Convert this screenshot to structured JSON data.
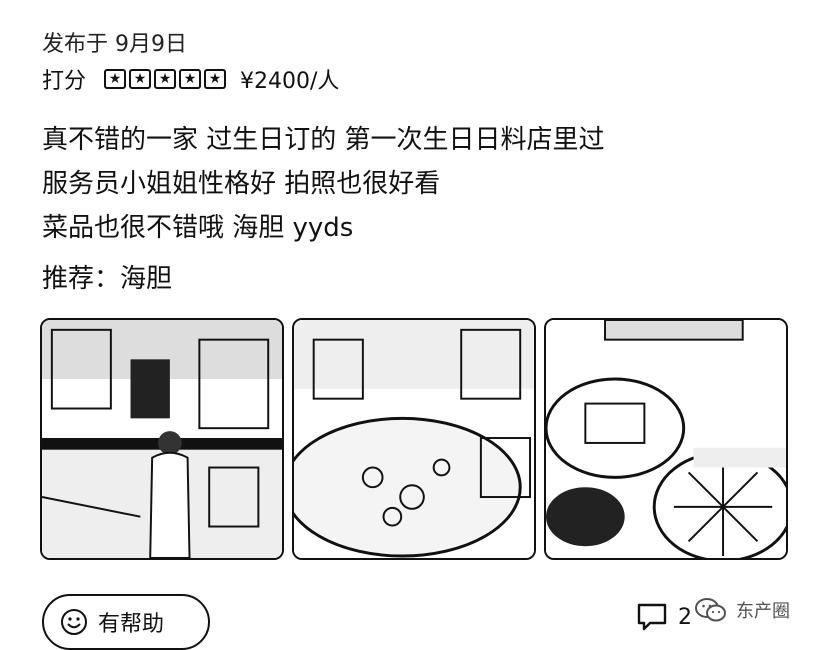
{
  "post": {
    "date": "发布于 9月9日",
    "rating_label": "打分",
    "rating_stars": 5,
    "price": "¥2400/人"
  },
  "review": {
    "lines": [
      "真不错的一家 过生日订的 第一次生日日料店里过",
      "服务员小姐姐性格好 拍照也很好看",
      "菜品也很不错哦 海胆 yyds"
    ]
  },
  "recommend": "推荐：海胆",
  "photos": [
    {
      "icon": "restaurant-interior-photo"
    },
    {
      "icon": "dish-platter-photo"
    },
    {
      "icon": "sea-urchin-dish-photo"
    }
  ],
  "actions": {
    "helpful_label": "有帮助",
    "comment_count": "2"
  },
  "watermark": {
    "text": "东产圈",
    "icon": "wechat-icon"
  }
}
